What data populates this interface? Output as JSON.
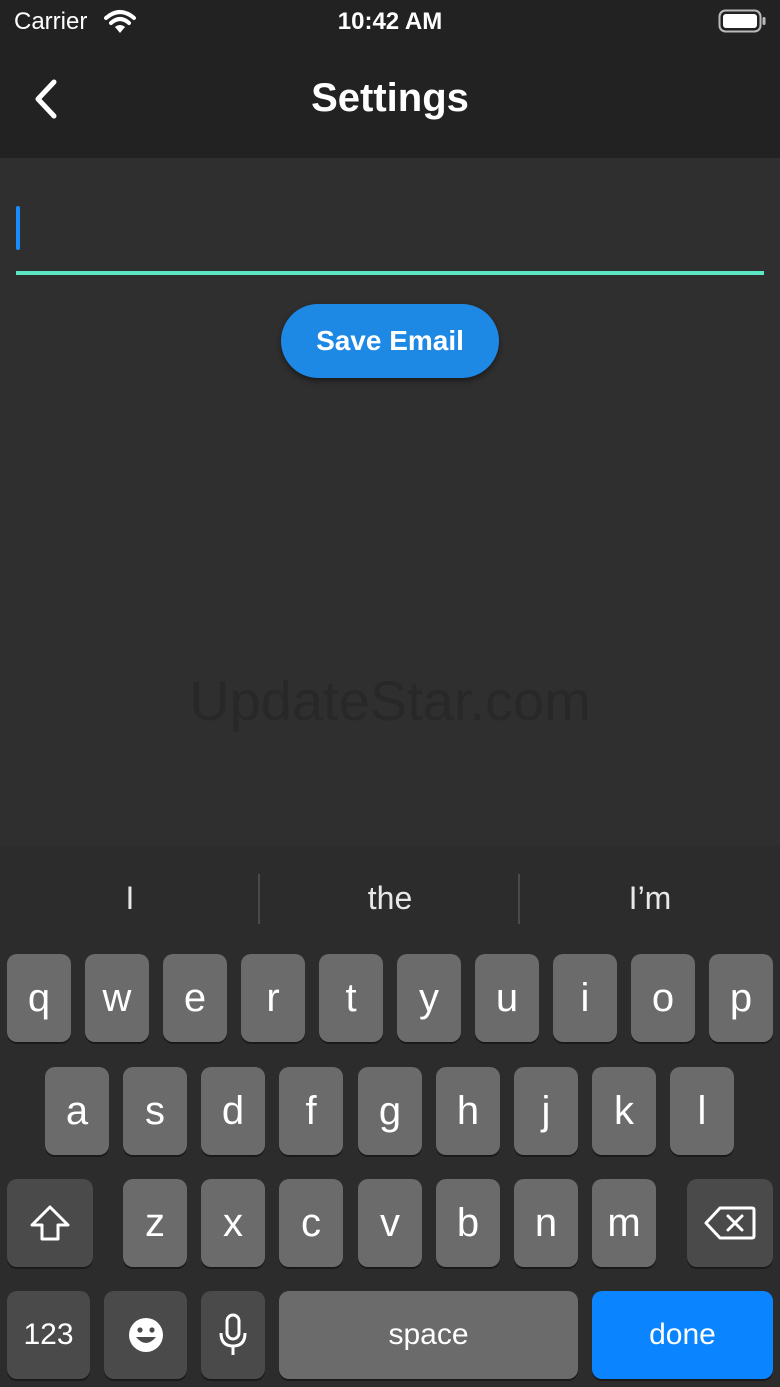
{
  "status_bar": {
    "carrier": "Carrier",
    "time": "10:42 AM"
  },
  "nav": {
    "title": "Settings"
  },
  "form": {
    "email_value": "",
    "email_placeholder": "",
    "save_label": "Save Email"
  },
  "watermark": "UpdateStar.com",
  "keyboard": {
    "suggestions": [
      "I",
      "the",
      "I’m"
    ],
    "row1": [
      "q",
      "w",
      "e",
      "r",
      "t",
      "y",
      "u",
      "i",
      "o",
      "p"
    ],
    "row2": [
      "a",
      "s",
      "d",
      "f",
      "g",
      "h",
      "j",
      "k",
      "l"
    ],
    "row3": [
      "z",
      "x",
      "c",
      "v",
      "b",
      "n",
      "m"
    ],
    "numbers_label": "123",
    "space_label": "space",
    "done_label": "done"
  },
  "colors": {
    "accent": "#1e88e5",
    "underline": "#5ae8c4",
    "done_key": "#0a84ff",
    "background": "#2f2f2f",
    "bar": "#222222"
  }
}
